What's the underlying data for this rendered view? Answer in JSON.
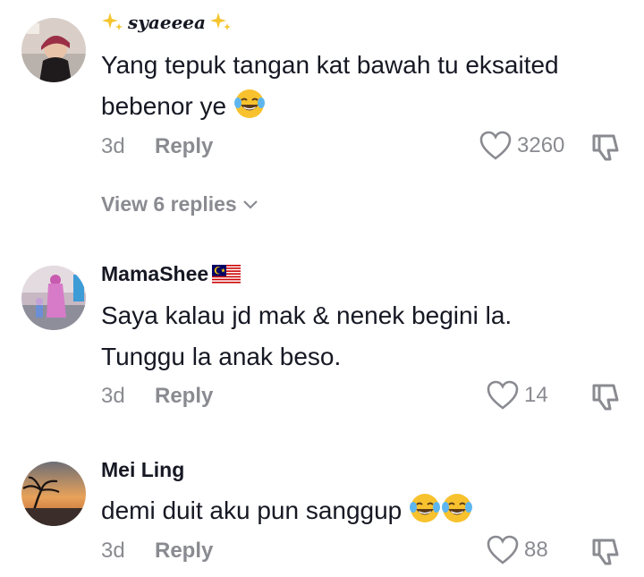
{
  "comments": [
    {
      "username": "syaeeea",
      "text": "Yang tepuk tangan kat bawah tu eksaited bebenor ye",
      "time": "3d",
      "reply_label": "Reply",
      "likes": "3260",
      "view_replies": "View 6 replies"
    },
    {
      "username": "MamaShee",
      "text_line1": "Saya kalau jd mak & nenek begini la.",
      "text_line2": "Tunggu la anak beso.",
      "time": "3d",
      "reply_label": "Reply",
      "likes": "14"
    },
    {
      "username": "Mei Ling",
      "text": "demi duit aku pun sanggup",
      "time": "3d",
      "reply_label": "Reply",
      "likes": "88"
    }
  ],
  "icons": {
    "like": "heart-outline-icon",
    "dislike": "thumbs-down-icon",
    "expand": "chevron-down-icon",
    "emoji": "face-with-tears-of-joy",
    "sparkles": "sparkles",
    "flag": "malaysia-flag"
  },
  "colors": {
    "text": "#161823",
    "secondary": "#8a8b91",
    "emoji_yellow": "#f8c22e"
  }
}
